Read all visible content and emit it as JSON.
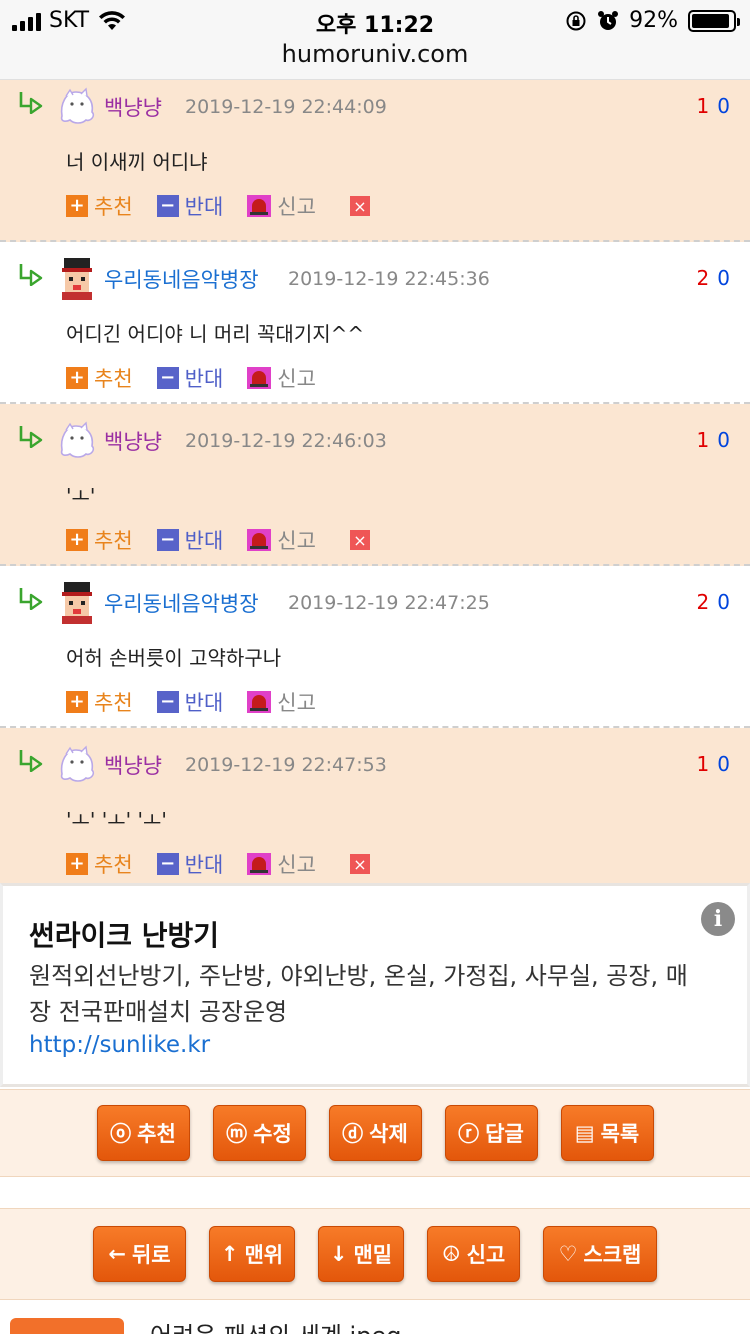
{
  "status_bar": {
    "carrier": "SKT",
    "time": "오후 11:22",
    "battery": "92%",
    "battery_level": 0.92,
    "url": "humoruniv.com"
  },
  "comments": [
    {
      "author": "백냥냥",
      "author_color": "#9a2fa3",
      "avatar": "ghost-cat-avatar",
      "date": "2019-12-19 22:44:09",
      "up": "1",
      "down": "0",
      "text": "너 이새끼 어디냐",
      "rec": "추천",
      "opp": "반대",
      "report": "신고",
      "has_delete": true
    },
    {
      "author": "우리동네음악병장",
      "author_color": "#1a6fd1",
      "avatar": "soldier-avatar",
      "date": "2019-12-19 22:45:36",
      "up": "2",
      "down": "0",
      "text": "어디긴 어디야 니 머리 꼭대기지^^",
      "rec": "추천",
      "opp": "반대",
      "report": "신고",
      "has_delete": false
    },
    {
      "author": "백냥냥",
      "author_color": "#9a2fa3",
      "avatar": "ghost-cat-avatar",
      "date": "2019-12-19 22:46:03",
      "up": "1",
      "down": "0",
      "text": "'ㅗ'",
      "rec": "추천",
      "opp": "반대",
      "report": "신고",
      "has_delete": true
    },
    {
      "author": "우리동네음악병장",
      "author_color": "#1a6fd1",
      "avatar": "soldier-avatar",
      "date": "2019-12-19 22:47:25",
      "up": "2",
      "down": "0",
      "text": "어허 손버릇이 고약하구나",
      "rec": "추천",
      "opp": "반대",
      "report": "신고",
      "has_delete": false
    },
    {
      "author": "백냥냥",
      "author_color": "#9a2fa3",
      "avatar": "ghost-cat-avatar",
      "date": "2019-12-19 22:47:53",
      "up": "1",
      "down": "0",
      "text": "'ㅗ' 'ㅗ' 'ㅗ'",
      "rec": "추천",
      "opp": "반대",
      "report": "신고",
      "has_delete": true
    }
  ],
  "ad": {
    "title": "썬라이크 난방기",
    "desc": "원적외선난방기, 주난방, 야외난방, 온실, 가정집, 사무실, 공장, 매장 전국판매설치 공장운영",
    "link": "http://sunlike.kr",
    "info_icon": "i"
  },
  "actions_row1": [
    {
      "icon": "ⓞ",
      "label": "추천"
    },
    {
      "icon": "ⓜ",
      "label": "수정"
    },
    {
      "icon": "ⓓ",
      "label": "삭제"
    },
    {
      "icon": "ⓡ",
      "label": "답글"
    },
    {
      "icon": "▤",
      "label": "목록"
    }
  ],
  "actions_row2": [
    {
      "icon": "←",
      "label": "뒤로"
    },
    {
      "icon": "↑",
      "label": "맨위"
    },
    {
      "icon": "↓",
      "label": "맨밑"
    },
    {
      "icon": "☮",
      "label": "신고"
    },
    {
      "icon": "♡",
      "label": "스크랩"
    }
  ],
  "next_post_peek": "어려운 패션의 세계.jpeg"
}
